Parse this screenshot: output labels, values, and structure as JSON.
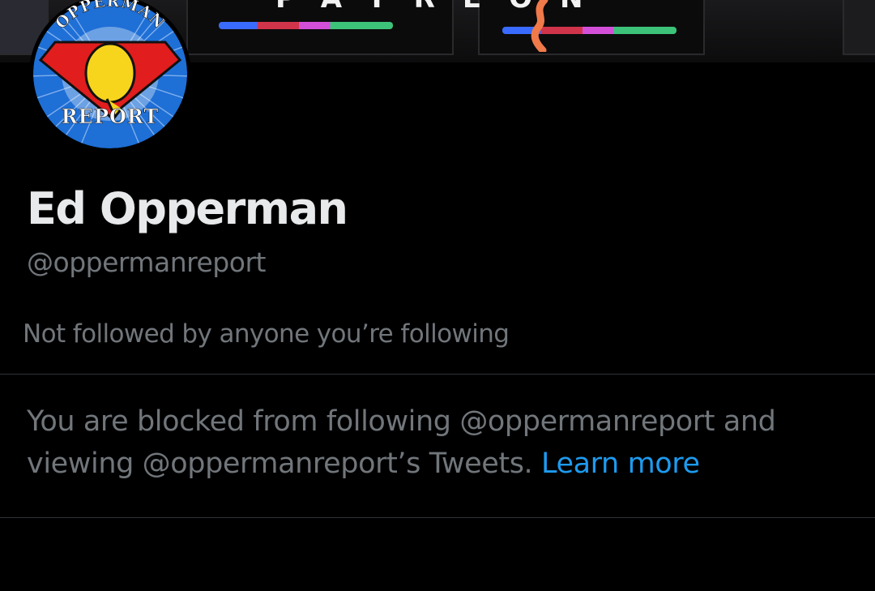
{
  "banner": {
    "letters": "PATREON"
  },
  "avatar": {
    "top_text": "OPPERMAN",
    "bottom_text": "REPORT",
    "ring_color": "#1e6fd6",
    "shield_color": "#e11d1d",
    "emblem_color": "#f7d51d"
  },
  "profile": {
    "display_name": "Ed Opperman",
    "handle": "@oppermanreport",
    "followers_you_know": "Not followed by anyone you’re following"
  },
  "blocked": {
    "line1": "You are blocked from following @oppermanreport and",
    "line2_text": "viewing @oppermanreport’s Tweets.",
    "learn_more_label": "Learn more",
    "link_color": "#1d9bf0"
  },
  "colors": {
    "background": "#000000",
    "primary_text": "#e7e9ea",
    "secondary_text": "#71767b",
    "divider": "#2f3336"
  }
}
